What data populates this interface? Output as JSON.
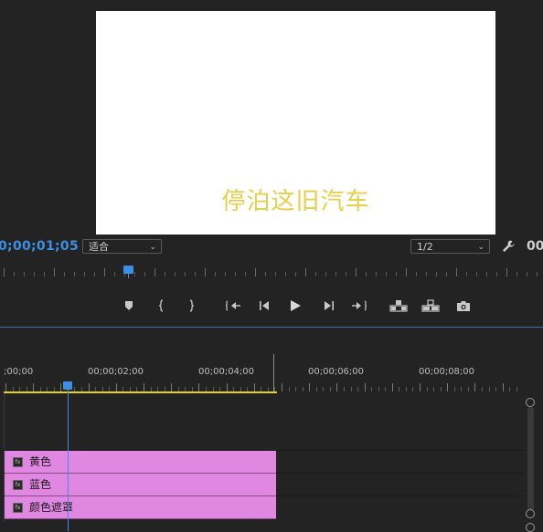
{
  "monitor": {
    "caption": "停泊这旧汽车",
    "caption_color": "#e6cf46",
    "current_timecode": "0;00;01;05",
    "fit_dropdown": "适合",
    "resolution_dropdown": "1/2",
    "end_timecode": "00:"
  },
  "transport": {
    "buttons": [
      "add-marker",
      "mark-in",
      "mark-out",
      "go-to-in",
      "step-back",
      "play",
      "step-forward",
      "go-to-out",
      "lift",
      "extract",
      "export-frame"
    ]
  },
  "timeline": {
    "ruler_labels": [
      ";00;00",
      "00;00;02;00",
      "00;00;04;00",
      "00;00;06;00",
      "00;00;08;00"
    ],
    "tracks": [
      {
        "name": "黄色",
        "color": "#e087e2"
      },
      {
        "name": "蓝色",
        "color": "#e087e2"
      },
      {
        "name": "颜色遮罩",
        "color": "#e087e2"
      }
    ],
    "work_area_color": "#e5d31b",
    "playhead_color": "#3d8fe3"
  }
}
